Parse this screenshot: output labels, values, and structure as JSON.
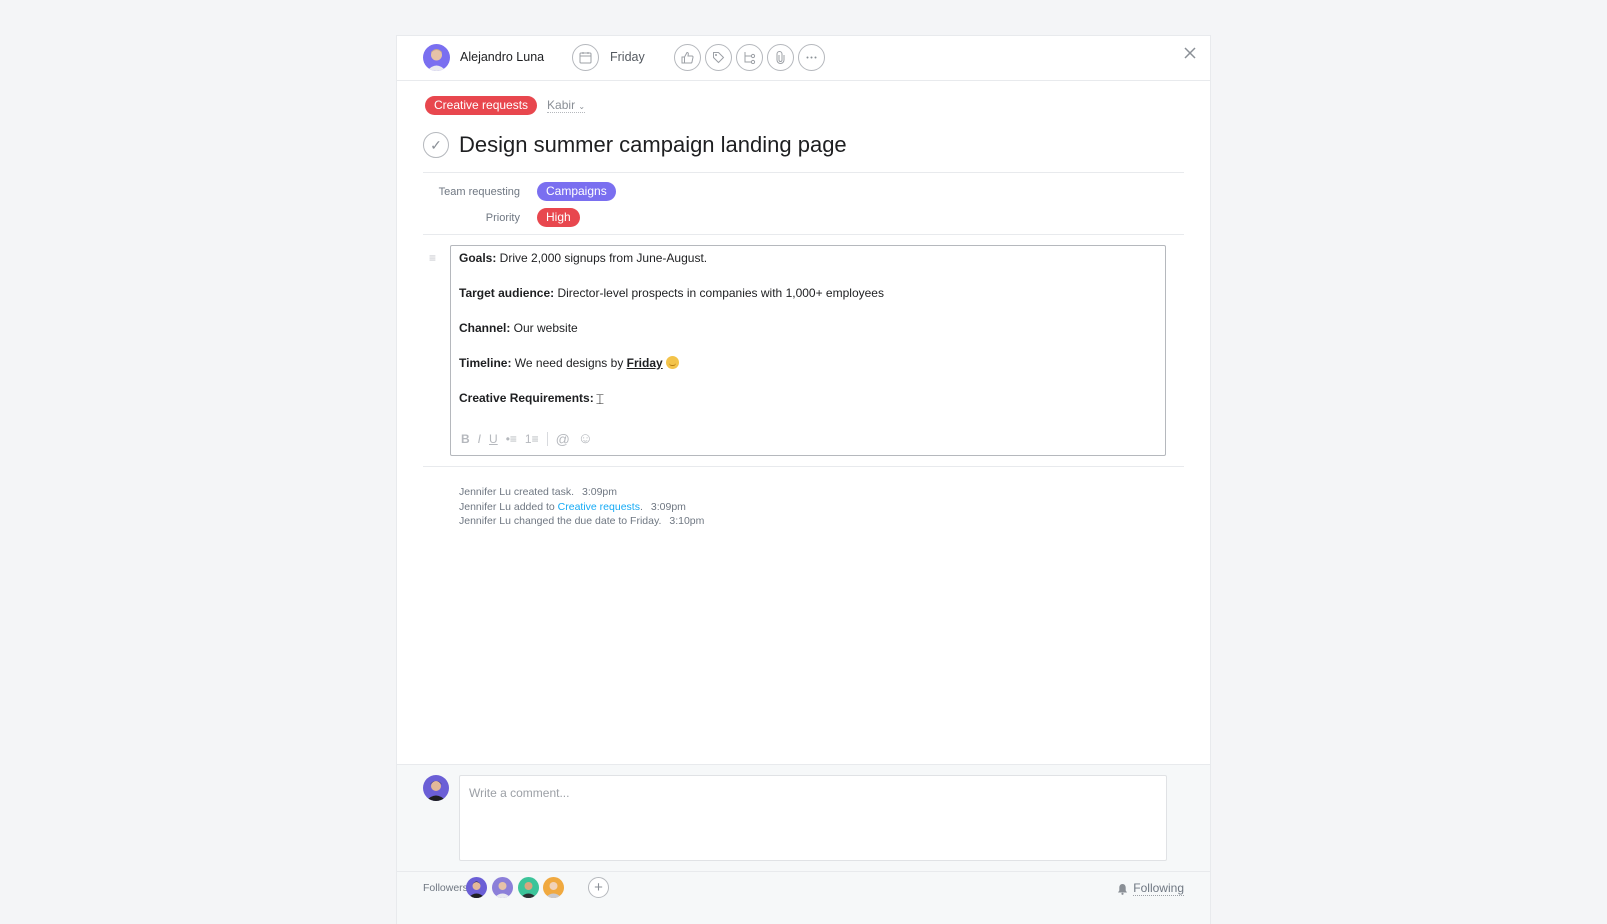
{
  "header": {
    "assignee": {
      "name": "Alejandro Luna",
      "avatar_color": "#7a6ff0"
    },
    "due_date": "Friday",
    "actions": [
      {
        "name": "like-button",
        "icon": "thumbs-up-icon"
      },
      {
        "name": "tag-button",
        "icon": "tag-icon"
      },
      {
        "name": "subtask-button",
        "icon": "subtask-icon"
      },
      {
        "name": "attachment-button",
        "icon": "paperclip-icon"
      },
      {
        "name": "more-button",
        "icon": "ellipsis-icon"
      }
    ],
    "close_icon": "close-icon"
  },
  "project_tag": {
    "label": "Creative requests",
    "color": "#e8474e"
  },
  "section": {
    "label": "Kabir"
  },
  "task": {
    "title": "Design summer campaign landing page",
    "completed": false
  },
  "fields": [
    {
      "label": "Team requesting",
      "value": "Campaigns",
      "color": "#7a6ff0"
    },
    {
      "label": "Priority",
      "value": "High",
      "color": "#e8474e"
    }
  ],
  "description": [
    {
      "key": "Goals:",
      "text": " Drive 2,000 signups from June-August."
    },
    {
      "key": "Target audience:",
      "text": " Director-level prospects in companies with 1,000+ employees"
    },
    {
      "key": "Channel:",
      "text": " Our website"
    },
    {
      "key": "Timeline:",
      "text": " We need designs by ",
      "mention": "Friday",
      "emoji": "grinning-face"
    },
    {
      "key": "Creative Requirements:",
      "text": ""
    }
  ],
  "editor_toolbar": [
    "B",
    "I",
    "U",
    "•≡",
    "1≡",
    "@",
    "☺"
  ],
  "activity": [
    {
      "text": "Jennifer Lu created task.",
      "time": "3:09pm"
    },
    {
      "text_before": "Jennifer Lu added to ",
      "link": "Creative requests",
      "text_after": ".",
      "time": "3:09pm"
    },
    {
      "text": "Jennifer Lu changed the due date to Friday.",
      "time": "3:10pm"
    }
  ],
  "comment": {
    "placeholder": "Write a comment..."
  },
  "followers": {
    "label": "Followers",
    "avatars": [
      "#6b5fd6",
      "#8c7fd9",
      "#3cc49a",
      "#f0a940"
    ]
  },
  "following": {
    "label": "Following"
  }
}
